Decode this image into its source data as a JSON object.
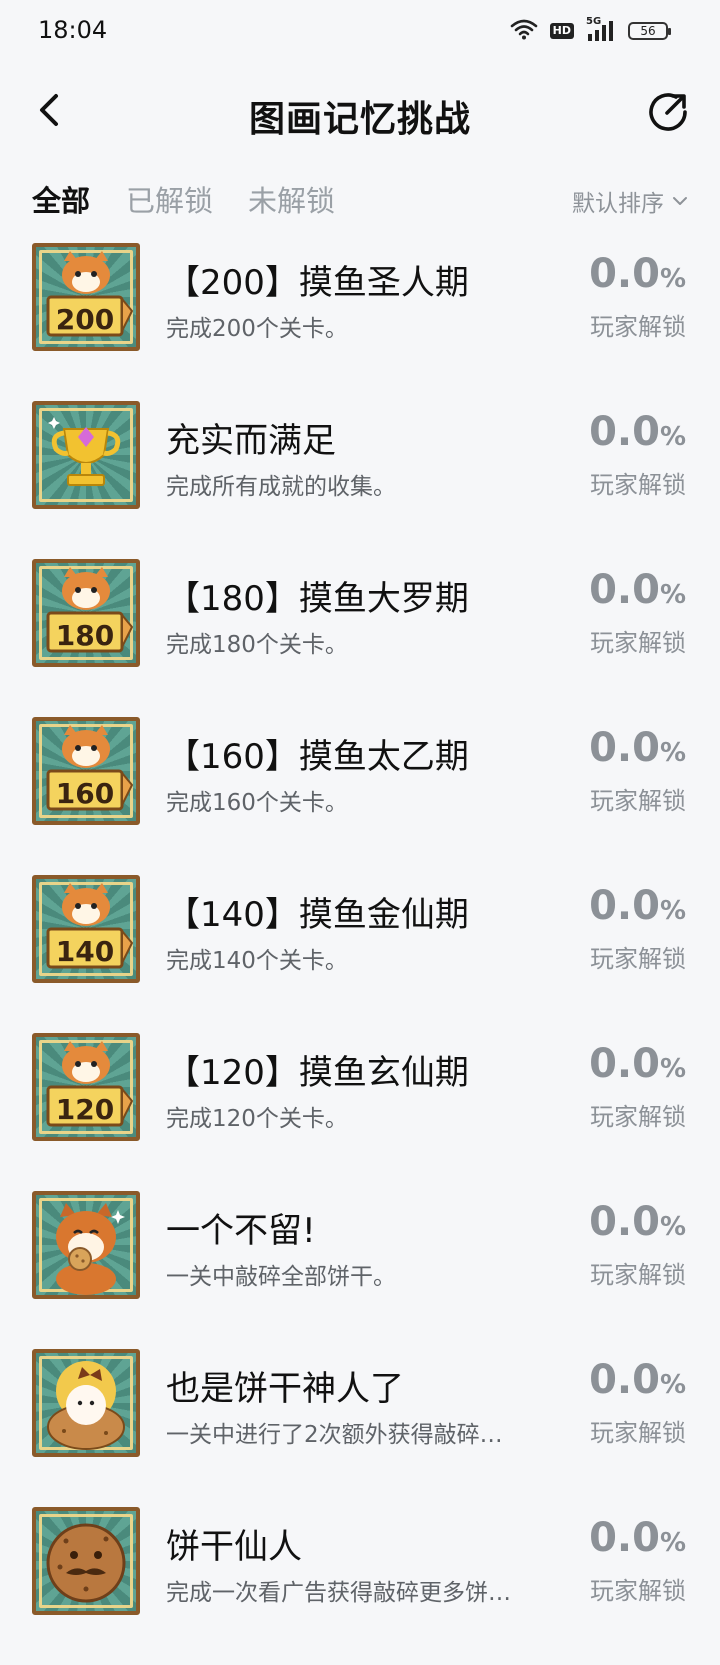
{
  "status_bar": {
    "time": "18:04",
    "hd": "HD",
    "network": "5G",
    "battery": "56"
  },
  "nav": {
    "title": "图画记忆挑战",
    "back_icon": "chevron-left-icon",
    "share_icon": "share-icon"
  },
  "tabs": [
    {
      "label": "全部",
      "active": true
    },
    {
      "label": "已解锁",
      "active": false
    },
    {
      "label": "未解锁",
      "active": false
    }
  ],
  "sort": {
    "label": "默认排序"
  },
  "achievements": [
    {
      "badge": "fox-200",
      "badge_text": "200",
      "title": "【200】摸鱼圣人期",
      "desc": "完成200个关卡。",
      "percent": "0.0",
      "unit": "%",
      "unlock_label": "玩家解锁"
    },
    {
      "badge": "trophy",
      "badge_text": "",
      "title": "充实而满足",
      "desc": "完成所有成就的收集。",
      "percent": "0.0",
      "unit": "%",
      "unlock_label": "玩家解锁"
    },
    {
      "badge": "fox-180",
      "badge_text": "180",
      "title": "【180】摸鱼大罗期",
      "desc": "完成180个关卡。",
      "percent": "0.0",
      "unit": "%",
      "unlock_label": "玩家解锁"
    },
    {
      "badge": "fox-160",
      "badge_text": "160",
      "title": "【160】摸鱼太乙期",
      "desc": "完成160个关卡。",
      "percent": "0.0",
      "unit": "%",
      "unlock_label": "玩家解锁"
    },
    {
      "badge": "fox-140",
      "badge_text": "140",
      "title": "【140】摸鱼金仙期",
      "desc": "完成140个关卡。",
      "percent": "0.0",
      "unit": "%",
      "unlock_label": "玩家解锁"
    },
    {
      "badge": "fox-120",
      "badge_text": "120",
      "title": "【120】摸鱼玄仙期",
      "desc": "完成120个关卡。",
      "percent": "0.0",
      "unit": "%",
      "unlock_label": "玩家解锁"
    },
    {
      "badge": "shiba-cookie",
      "badge_text": "",
      "title": "一个不留!",
      "desc": "一关中敲碎全部饼干。",
      "percent": "0.0",
      "unit": "%",
      "unlock_label": "玩家解锁"
    },
    {
      "badge": "girl-cookie",
      "badge_text": "",
      "title": "也是饼干神人了",
      "desc": "一关中进行了2次额外获得敲碎…",
      "percent": "0.0",
      "unit": "%",
      "unlock_label": "玩家解锁"
    },
    {
      "badge": "face-cookie",
      "badge_text": "",
      "title": "饼干仙人",
      "desc": "完成一次看广告获得敲碎更多饼…",
      "percent": "0.0",
      "unit": "%",
      "unlock_label": "玩家解锁"
    }
  ]
}
